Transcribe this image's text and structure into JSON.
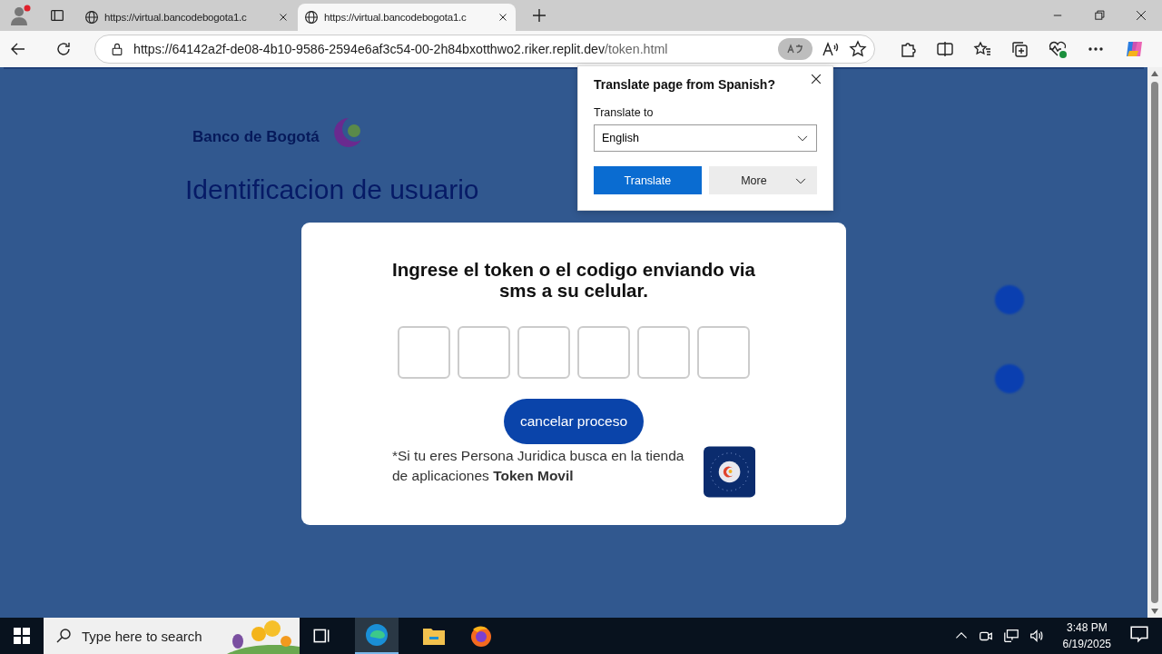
{
  "browser": {
    "tabs": [
      {
        "title": "https://virtual.bancodebogota1.c",
        "selected": false
      },
      {
        "title": "https://virtual.bancodebogota1.c",
        "selected": true
      }
    ],
    "address": {
      "host": "https://64142a2f-de08-4b10-9586-2594e6af3c54-00-2h84bxotthwo2.riker.replit.dev",
      "path": "/token.html"
    }
  },
  "page": {
    "logo_text": "Banco de Bogotá",
    "heading": "Identificacion de usuario"
  },
  "translate_popup": {
    "title": "Translate page from Spanish?",
    "label": "Translate to",
    "language": "English",
    "primary_button": "Translate",
    "more_button": "More"
  },
  "modal": {
    "title": "Ingrese el token o el codigo enviando via sms a su celular.",
    "button": "cancelar proceso",
    "note": "*Si tu eres Persona Juridica busca en la tienda de aplicaciones **Token Movil**"
  },
  "taskbar": {
    "search_placeholder": "Type here to search",
    "time": "3:48 PM",
    "date": "6/19/2025"
  }
}
